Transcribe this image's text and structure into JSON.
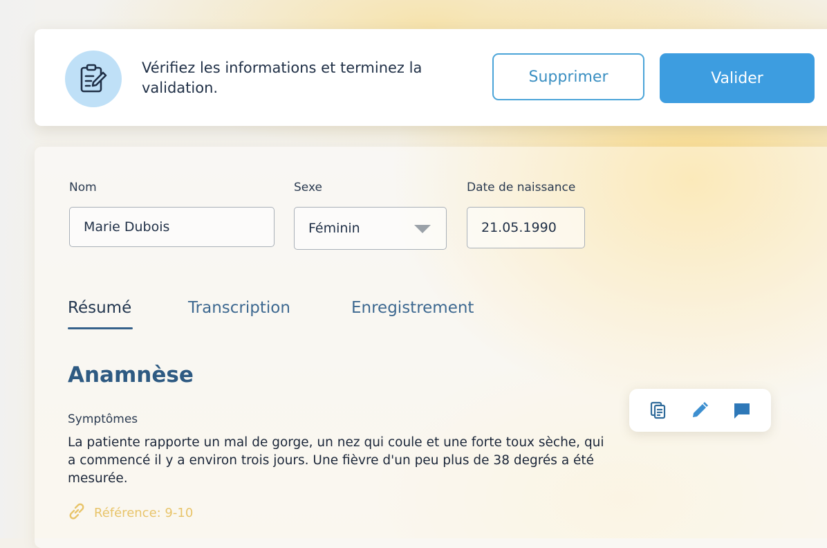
{
  "header": {
    "message": "Vérifiez les informations et terminez la validation.",
    "delete_label": "Supprimer",
    "validate_label": "Valider",
    "icon": "clipboard-edit-icon"
  },
  "form": {
    "name": {
      "label": "Nom",
      "value": "Marie Dubois"
    },
    "sex": {
      "label": "Sexe",
      "value": "Féminin"
    },
    "birthdate": {
      "label": "Date de naissance",
      "value": "21.05.1990"
    }
  },
  "tabs": [
    {
      "label": "Résumé",
      "active": true
    },
    {
      "label": "Transcription",
      "active": false
    },
    {
      "label": "Enregistrement",
      "active": false
    }
  ],
  "section": {
    "title": "Anamnèse",
    "subsection_label": "Symptômes",
    "text": "La patiente rapporte un mal de gorge, un nez qui coule et une forte toux sèche, qui a commencé il y a environ trois jours. Une fièvre d'un peu plus de 38 degrés a été mesurée.",
    "reference": "Référence: 9-10"
  },
  "actions": [
    "copy-icon",
    "edit-pencil-icon",
    "comment-icon"
  ],
  "colors": {
    "accent": "#3d9de0",
    "outline": "#4aa4d8",
    "title": "#2e5a82",
    "reference": "#e8c46a",
    "badge": "#bfe0f7"
  }
}
